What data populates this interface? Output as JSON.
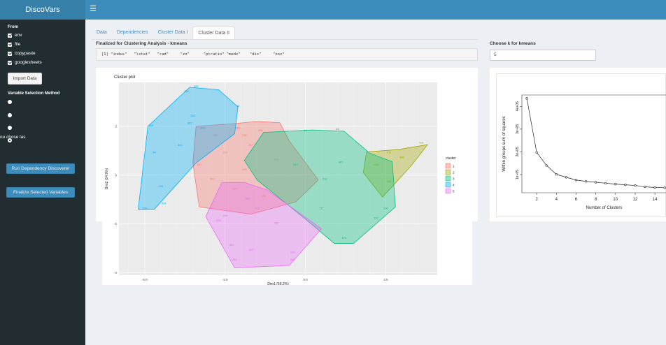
{
  "header": {
    "brand": "DiscoVars",
    "menu_icon": "hamburger-icon"
  },
  "sidebar": {
    "from_label": "From",
    "sources": [
      "env",
      "file",
      "copypaste",
      "googlesheets"
    ],
    "import_button": "Import Data",
    "method_label": "Variable Selection Method",
    "methods": [
      "",
      "",
      "",
      ""
    ],
    "method_selected_index": 3,
    "chose_text": "ou chose las",
    "run_button": "Run Dependency Discoverer",
    "finalize_button": "Finalize Selected Variables"
  },
  "tabs": {
    "items": [
      "Data",
      "Dependencies",
      "Cluster Data I",
      "Cluster Data II"
    ],
    "active_index": 3
  },
  "main": {
    "final_title": "Finalized for Clustering Analysis - kmeans",
    "final_output": "[1] \"indus\"   \"lstat\"   \"rad\"     \"zn\"      \"ptratio\" \"medv\"    \"dis\"     \"nox\"",
    "k_label": "Choose k for kmeans",
    "k_value": "5"
  },
  "chart_data": [
    {
      "type": "scatter",
      "title": "Cluster plot",
      "xlabel": "Dim1 (56.2%)",
      "ylabel": "Dim2 (14.9%)",
      "xlim": [
        -5.8,
        4.1
      ],
      "ylim": [
        -4.1,
        3.8
      ],
      "x_ticks": [
        -5.0,
        -2.5,
        0.0,
        2.5
      ],
      "x_tick_labels": [
        "-5.0",
        "-2.5",
        "0.0",
        "2.5"
      ],
      "y_ticks": [
        2,
        0,
        -2,
        -4
      ],
      "y_tick_labels": [
        "2",
        "0",
        "-2",
        "-4"
      ],
      "grid": true,
      "legend_position": "right",
      "legend_title": "cluster",
      "series": [
        {
          "name": "1",
          "color": "#f8766d",
          "hull": [
            [
              -3.4,
              2.0
            ],
            [
              -2.3,
              2.1
            ],
            [
              -1.5,
              2.2
            ],
            [
              -0.8,
              2.15
            ],
            [
              -0.5,
              1.4
            ],
            [
              0.4,
              -0.2
            ],
            [
              -0.3,
              -1.1
            ],
            [
              -1.7,
              -1.6
            ],
            [
              -3.3,
              -1.3
            ],
            [
              -3.5,
              0.5
            ]
          ],
          "labels": [
            [
              "-2.1",
              1.9,
              "251"
            ],
            [
              "-2.8",
              1.6,
              "252"
            ],
            [
              "-1.9",
              1.6,
              "235"
            ],
            [
              "-1.4",
              1.8,
              "248"
            ],
            [
              "-1.7",
              1.2,
              "287"
            ],
            [
              "-2.5",
              0.9,
              "232"
            ],
            [
              "-3.3",
              0.4,
              "241"
            ],
            [
              "-2.9",
              -0.2,
              "203"
            ],
            [
              "-2.2",
              -0.6,
              "214"
            ],
            [
              "-1.3",
              -0.9,
              "166"
            ],
            [
              "-1.9",
              0.2,
              "199"
            ],
            [
              "-0.9",
              0.6,
              "170"
            ]
          ]
        },
        {
          "name": "2",
          "color": "#a3a500",
          "hull": [
            [
              1.9,
              0.95
            ],
            [
              2.9,
              1.05
            ],
            [
              3.8,
              1.25
            ],
            [
              3.3,
              0.4
            ],
            [
              2.4,
              -0.9
            ],
            [
              1.8,
              0.1
            ]
          ],
          "labels": [
            [
              "3.6",
              1.3,
              "415"
            ],
            [
              "2.6",
              0.9,
              "411"
            ],
            [
              "2.2",
              0.4,
              "433"
            ],
            [
              "3.0",
              0.7,
              "466"
            ],
            [
              "2.6",
              -0.3,
              "435"
            ]
          ]
        },
        {
          "name": "3",
          "color": "#00bf7d",
          "hull": [
            [
              -1.3,
              1.75
            ],
            [
              0.2,
              1.85
            ],
            [
              1.2,
              1.8
            ],
            [
              2.0,
              0.9
            ],
            [
              2.7,
              0.55
            ],
            [
              2.8,
              -1.3
            ],
            [
              1.5,
              -2.8
            ],
            [
              0.9,
              -2.8
            ],
            [
              0.0,
              -1.8
            ],
            [
              -1.5,
              -0.2
            ],
            [
              -1.9,
              0.6
            ]
          ],
          "labels": [
            [
              "0.0",
              1.8,
              "49"
            ],
            [
              "1.0",
              1.85,
              "33"
            ],
            [
              "1.1",
              0.5,
              "497"
            ],
            [
              "0.6",
              -0.2,
              "218"
            ],
            [
              "0.5",
              -1.4,
              "171"
            ],
            [
              "2.5",
              -1.4,
              "160"
            ],
            [
              "2.2",
              -1.8,
              "157"
            ],
            [
              "1.2",
              -2.6,
              "165"
            ],
            [
              "-0.3",
              0.4,
              "417"
            ]
          ]
        },
        {
          "name": "4",
          "color": "#00b0f6",
          "hull": [
            [
              -4.9,
              2.0
            ],
            [
              -3.6,
              3.6
            ],
            [
              -2.7,
              3.5
            ],
            [
              -2.1,
              2.8
            ],
            [
              -2.2,
              1.7
            ],
            [
              -3.4,
              0.5
            ],
            [
              -4.7,
              -1.4
            ],
            [
              -5.2,
              -1.4
            ]
          ],
          "labels": [
            [
              "-3.4",
              3.6,
              "355"
            ],
            [
              "-3.7",
              3.4,
              "356"
            ],
            [
              "-2.1",
              2.8,
              "48"
            ],
            [
              "-3.5",
              2.4,
              "363"
            ],
            [
              "-3.6",
              2.1,
              "362"
            ],
            [
              "-4.8",
              2.0,
              "354"
            ],
            [
              "-3.2",
              1.9,
              "348"
            ],
            [
              "-4.7",
              0.9,
              "54"
            ],
            [
              "-3.9",
              1.2,
              "346"
            ],
            [
              "-4.5",
              -0.5,
              "199"
            ],
            [
              "-5.0",
              -1.4,
              "284"
            ],
            [
              "-4.4",
              -1.2,
              "354"
            ]
          ]
        },
        {
          "name": "5",
          "color": "#e76bf3",
          "hull": [
            [
              -2.6,
              -0.3
            ],
            [
              -1.9,
              -0.3
            ],
            [
              -1.2,
              -0.6
            ],
            [
              0.5,
              -2.2
            ],
            [
              -0.5,
              -3.7
            ],
            [
              -2.2,
              -3.8
            ],
            [
              -3.1,
              -1.7
            ]
          ],
          "labels": [
            [
              "-2.5",
              -1.7,
              "264"
            ],
            [
              "-2.7",
              -1.9,
              "260"
            ],
            [
              "-1.8",
              -1.0,
              "388"
            ],
            [
              "-1.5",
              -1.4,
              "405"
            ],
            [
              "-2.3",
              -2.9,
              "363"
            ],
            [
              "-1.7",
              -3.1,
              "262"
            ],
            [
              "-2.2",
              -3.5,
              "263"
            ],
            [
              "-0.4",
              -3.5,
              "380"
            ],
            [
              "-0.4",
              -3.2,
              "158"
            ],
            [
              "-0.9",
              -2.0,
              "366"
            ]
          ]
        }
      ]
    },
    {
      "type": "line",
      "title": "",
      "xlabel": "Number of Clusters",
      "ylabel": "Within groups sum of squares",
      "x": [
        1,
        2,
        3,
        4,
        5,
        6,
        7,
        8,
        9,
        10,
        11,
        12,
        13,
        14,
        15
      ],
      "values": [
        435000,
        198000,
        140000,
        101000,
        88000,
        76000,
        70000,
        66000,
        62000,
        58000,
        55000,
        52000,
        46000,
        43000,
        42000
      ],
      "xlim": [
        0.5,
        15.2
      ],
      "ylim": [
        20000,
        450000
      ],
      "x_ticks": [
        2,
        4,
        6,
        8,
        10,
        12,
        14
      ],
      "x_tick_labels": [
        "2",
        "4",
        "6",
        "8",
        "10",
        "12",
        "14"
      ],
      "y_ticks": [
        100000,
        200000,
        300000,
        400000
      ],
      "y_tick_labels": [
        "1e+05",
        "2e+05",
        "3e+05",
        "4e+05"
      ]
    }
  ]
}
